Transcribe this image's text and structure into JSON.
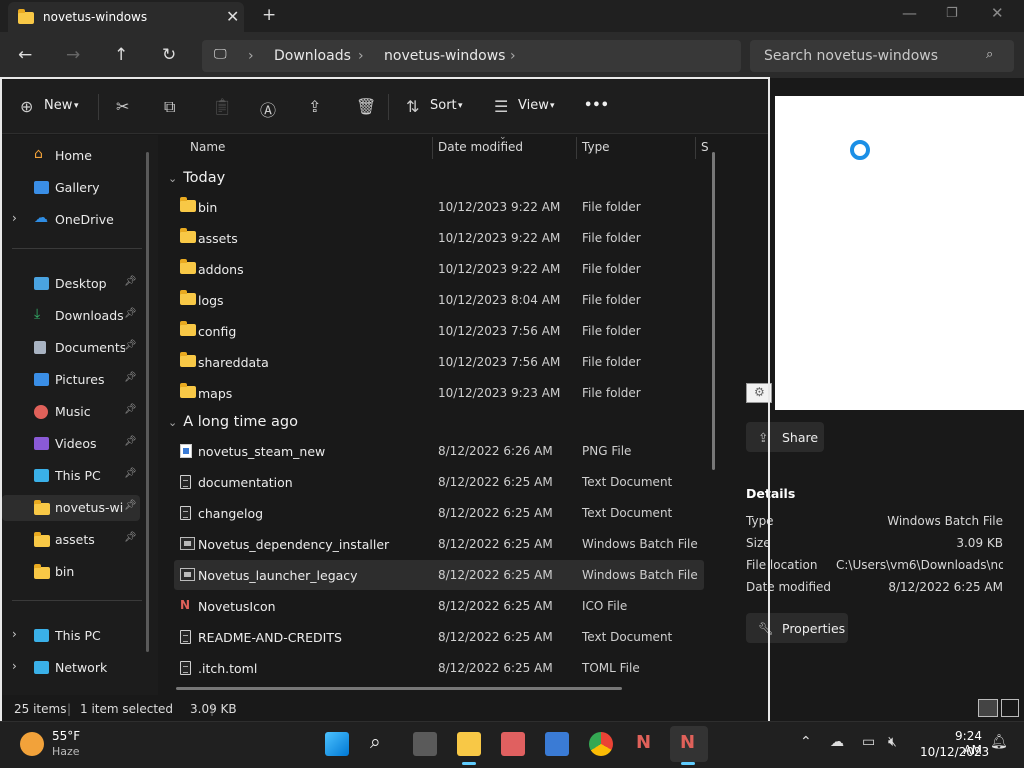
{
  "window": {
    "tab_title": "novetus-windows",
    "new_tab": "+"
  },
  "nav": {
    "breadcrumb": [
      "Downloads",
      "novetus-windows"
    ],
    "search_placeholder": "Search novetus-windows"
  },
  "toolbar": {
    "new_label": "New",
    "sort_label": "Sort",
    "view_label": "View",
    "more_label": "•••"
  },
  "sidebar": {
    "items": [
      {
        "label": "Home",
        "icon": "home-icon",
        "color": "#f2a23a"
      },
      {
        "label": "Gallery",
        "icon": "gallery-icon",
        "color": "#3a8ee6"
      },
      {
        "label": "OneDrive",
        "icon": "cloud-icon",
        "color": "#2f8de4"
      },
      {
        "label": "Desktop",
        "icon": "desktop-icon",
        "color": "#4aa3e0"
      },
      {
        "label": "Downloads",
        "icon": "download-icon",
        "color": "#34b36a"
      },
      {
        "label": "Documents",
        "icon": "documents-icon",
        "color": "#a8b3c2"
      },
      {
        "label": "Pictures",
        "icon": "pictures-icon",
        "color": "#3a8ee6"
      },
      {
        "label": "Music",
        "icon": "music-icon",
        "color": "#e0615a"
      },
      {
        "label": "Videos",
        "icon": "videos-icon",
        "color": "#8a5ad6"
      },
      {
        "label": "This PC",
        "icon": "pc-icon",
        "color": "#3ab0e8"
      },
      {
        "label": "novetus-windows",
        "icon": "folder-icon",
        "color": "#f8c846"
      },
      {
        "label": "assets",
        "icon": "folder-icon",
        "color": "#f8c846"
      },
      {
        "label": "bin",
        "icon": "folder-icon",
        "color": "#f8c846"
      },
      {
        "label": "This PC",
        "icon": "pc-icon",
        "color": "#3ab0e8"
      },
      {
        "label": "Network",
        "icon": "network-icon",
        "color": "#3ab0e8"
      }
    ]
  },
  "list": {
    "columns": [
      "Name",
      "Date modified",
      "Type",
      "S"
    ],
    "groups": [
      {
        "label": "Today",
        "rows": [
          {
            "name": "bin",
            "date": "10/12/2023 9:22 AM",
            "type": "File folder",
            "icon": "folder"
          },
          {
            "name": "assets",
            "date": "10/12/2023 9:22 AM",
            "type": "File folder",
            "icon": "folder"
          },
          {
            "name": "addons",
            "date": "10/12/2023 9:22 AM",
            "type": "File folder",
            "icon": "folder"
          },
          {
            "name": "logs",
            "date": "10/12/2023 8:04 AM",
            "type": "File folder",
            "icon": "folder"
          },
          {
            "name": "config",
            "date": "10/12/2023 7:56 AM",
            "type": "File folder",
            "icon": "folder"
          },
          {
            "name": "shareddata",
            "date": "10/12/2023 7:56 AM",
            "type": "File folder",
            "icon": "folder"
          },
          {
            "name": "maps",
            "date": "10/12/2023 9:23 AM",
            "type": "File folder",
            "icon": "folder"
          }
        ]
      },
      {
        "label": "A long time ago",
        "rows": [
          {
            "name": "novetus_steam_new",
            "date": "8/12/2022 6:26 AM",
            "type": "PNG File",
            "icon": "png"
          },
          {
            "name": "documentation",
            "date": "8/12/2022 6:25 AM",
            "type": "Text Document",
            "icon": "doc"
          },
          {
            "name": "changelog",
            "date": "8/12/2022 6:25 AM",
            "type": "Text Document",
            "icon": "doc"
          },
          {
            "name": "Novetus_dependency_installer",
            "date": "8/12/2022 6:25 AM",
            "type": "Windows Batch File",
            "icon": "bat"
          },
          {
            "name": "Novetus_launcher_legacy",
            "date": "8/12/2022 6:25 AM",
            "type": "Windows Batch File",
            "icon": "bat",
            "selected": true
          },
          {
            "name": "NovetusIcon",
            "date": "8/12/2022 6:25 AM",
            "type": "ICO File",
            "icon": "ico"
          },
          {
            "name": "README-AND-CREDITS",
            "date": "8/12/2022 6:25 AM",
            "type": "Text Document",
            "icon": "doc"
          },
          {
            "name": ".itch.toml",
            "date": "8/12/2022 6:25 AM",
            "type": "TOML File",
            "icon": "doc"
          }
        ]
      }
    ]
  },
  "details": {
    "share_label": "Share",
    "heading": "Details",
    "fields": [
      {
        "key": "Type",
        "value": "Windows Batch File"
      },
      {
        "key": "Size",
        "value": "3.09 KB"
      },
      {
        "key": "File location",
        "value": "C:\\Users\\vm6\\Downloads\\no..."
      },
      {
        "key": "Date modified",
        "value": "8/12/2022 6:25 AM"
      }
    ],
    "properties_label": "Properties"
  },
  "status": {
    "items_count": "25 items",
    "selected": "1 item selected",
    "size": "3.09 KB"
  },
  "taskbar": {
    "weather_temp": "55°F",
    "weather_desc": "Haze",
    "time": "9:24 AM",
    "date": "10/12/2023"
  }
}
